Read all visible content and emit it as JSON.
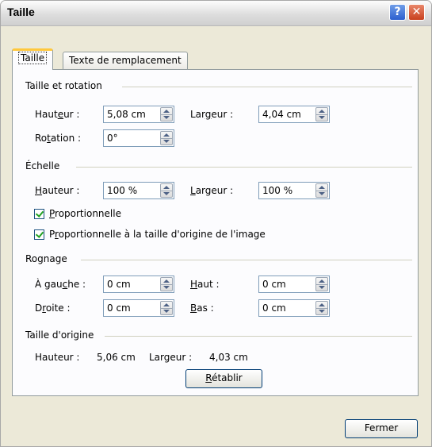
{
  "window": {
    "title": "Taille"
  },
  "tabs": [
    {
      "label": "Taille",
      "active": true
    },
    {
      "label": "Texte de remplacement",
      "active": false
    }
  ],
  "size_rotation": {
    "heading": "Taille et rotation",
    "height_label_pre": "Haut",
    "height_label_u": "e",
    "height_label_post": "ur :",
    "height_value": "5,08 cm",
    "width_label_pre": "Lar",
    "width_label_u": "g",
    "width_label_post": "eur :",
    "width_value": "4,04 cm",
    "rotation_label_pre": "Ro",
    "rotation_label_u": "t",
    "rotation_label_post": "ation :",
    "rotation_value": "0°"
  },
  "scale": {
    "heading": "Échelle",
    "height_label_u": "H",
    "height_label_post": "auteur :",
    "height_value": "100 %",
    "width_label_u": "L",
    "width_label_post": "argeur :",
    "width_value": "100 %",
    "lock_u": "P",
    "lock_post": "roportionnelle",
    "lock_checked": true,
    "relative_pre": "P",
    "relative_u": "r",
    "relative_post": "oportionnelle à la taille d'origine de l'image",
    "relative_checked": true
  },
  "crop": {
    "heading": "Rognage",
    "left_label_pre": "À gau",
    "left_label_u": "c",
    "left_label_post": "he :",
    "left_value": "0 cm",
    "top_label_u": "H",
    "top_label_post": "aut :",
    "top_value": "0 cm",
    "right_label_pre": "D",
    "right_label_u": "r",
    "right_label_post": "oite :",
    "right_value": "0 cm",
    "bottom_label_u": "B",
    "bottom_label_post": "as :",
    "bottom_value": "0 cm"
  },
  "original": {
    "heading": "Taille d'origine",
    "height_label": "Hauteur :",
    "height_value": "5,06 cm",
    "width_label": "Largeur :",
    "width_value": "4,03 cm",
    "reset_u": "R",
    "reset_post": "établir"
  },
  "footer": {
    "close_label": "Fermer"
  }
}
